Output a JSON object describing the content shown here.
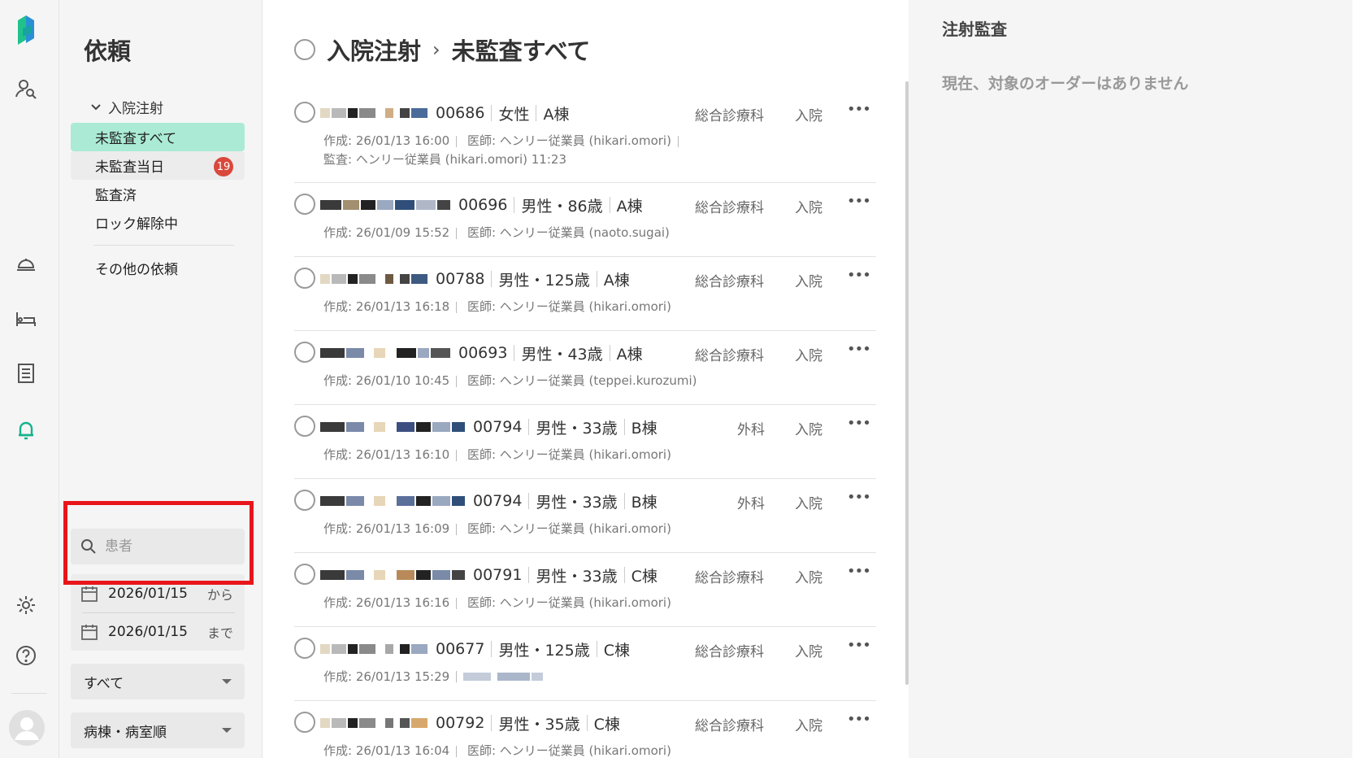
{
  "sidebar": {
    "title": "依頼",
    "group_label": "入院注射",
    "items": [
      {
        "label": "未監査すべて"
      },
      {
        "label": "未監査当日",
        "badge": "19"
      },
      {
        "label": "監査済"
      },
      {
        "label": "ロック解除中"
      }
    ],
    "other_label": "その他の依頼",
    "search_placeholder": "患者",
    "date_from": "2026/01/15",
    "date_from_suffix": "から",
    "date_to": "2026/01/15",
    "date_to_suffix": "まで",
    "filter_select": "すべて",
    "sort_select": "病棟・病室順"
  },
  "main": {
    "breadcrumb_parent": "入院注射",
    "breadcrumb_chevron": "›",
    "breadcrumb_current": "未監査すべて",
    "rows": [
      {
        "id": "00686",
        "sex_age": "女性",
        "ward": "A棟",
        "dept": "総合診療科",
        "admission": "入院",
        "created": "作成: 26/01/13 16:00",
        "doctor": "医師: ヘンリー従業員 (hikari.omori)",
        "audit": "監査: ヘンリー従業員 (hikari.omori) 11:23"
      },
      {
        "id": "00696",
        "sex_age": "男性・86歳",
        "ward": "A棟",
        "dept": "総合診療科",
        "admission": "入院",
        "created": "作成: 26/01/09 15:52",
        "doctor": "医師: ヘンリー従業員 (naoto.sugai)"
      },
      {
        "id": "00788",
        "sex_age": "男性・125歳",
        "ward": "A棟",
        "dept": "総合診療科",
        "admission": "入院",
        "created": "作成: 26/01/13 16:18",
        "doctor": "医師: ヘンリー従業員 (hikari.omori)"
      },
      {
        "id": "00693",
        "sex_age": "男性・43歳",
        "ward": "A棟",
        "dept": "総合診療科",
        "admission": "入院",
        "created": "作成: 26/01/10 10:45",
        "doctor": "医師: ヘンリー従業員 (teppei.kurozumi)"
      },
      {
        "id": "00794",
        "sex_age": "男性・33歳",
        "ward": "B棟",
        "dept": "外科",
        "admission": "入院",
        "created": "作成: 26/01/13 16:10",
        "doctor": "医師: ヘンリー従業員 (hikari.omori)"
      },
      {
        "id": "00794",
        "sex_age": "男性・33歳",
        "ward": "B棟",
        "dept": "外科",
        "admission": "入院",
        "created": "作成: 26/01/13 16:09",
        "doctor": "医師: ヘンリー従業員 (hikari.omori)"
      },
      {
        "id": "00791",
        "sex_age": "男性・33歳",
        "ward": "C棟",
        "dept": "総合診療科",
        "admission": "入院",
        "created": "作成: 26/01/13 16:16",
        "doctor": "医師: ヘンリー従業員 (hikari.omori)"
      },
      {
        "id": "00677",
        "sex_age": "男性・125歳",
        "ward": "C棟",
        "dept": "総合診療科",
        "admission": "入院",
        "created": "作成: 26/01/13 15:29",
        "doctor": ""
      },
      {
        "id": "00792",
        "sex_age": "男性・35歳",
        "ward": "C棟",
        "dept": "総合診療科",
        "admission": "入院",
        "created": "作成: 26/01/13 16:04",
        "doctor": "医師: ヘンリー従業員 (hikari.omori)"
      }
    ]
  },
  "detail": {
    "title": "注射監査",
    "empty_message": "現在、対象のオーダーはありません"
  },
  "colors": {
    "accent": "#abebd5",
    "badge": "#d9483b",
    "highlight": "#e8161b",
    "logo_green": "#1fc28a",
    "logo_blue": "#2a8fd6"
  },
  "icons": [
    "logo-icon",
    "patient-search-icon",
    "food-tray-icon",
    "bed-icon",
    "document-list-icon",
    "bell-icon",
    "gear-icon",
    "help-icon",
    "avatar-icon",
    "chevron-down-icon",
    "search-icon",
    "calendar-icon",
    "more-icon"
  ]
}
